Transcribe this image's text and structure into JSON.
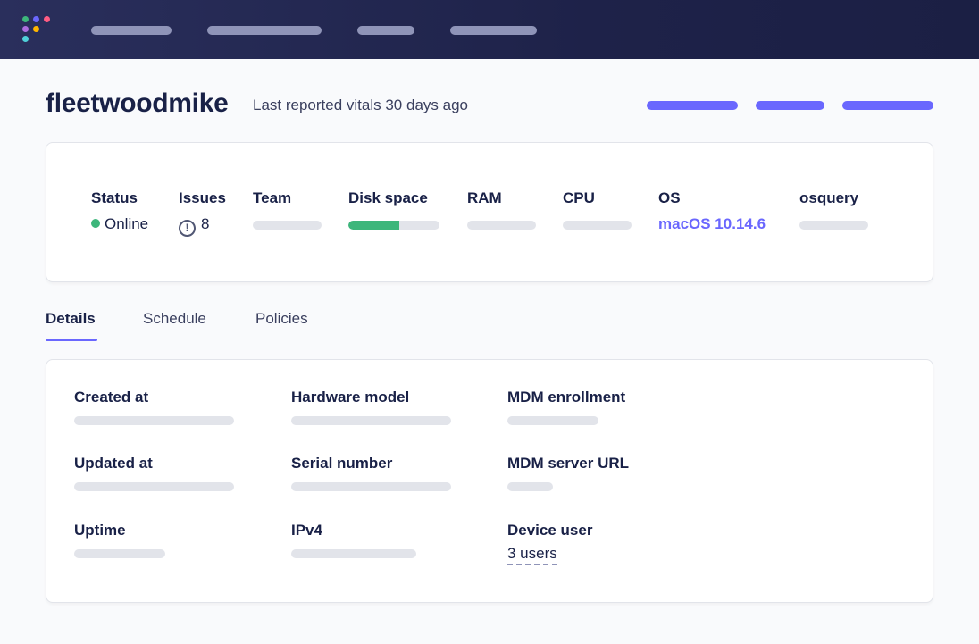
{
  "colors": {
    "topbar": "#1e2249",
    "accent": "#6a67fe",
    "online": "#3db67b",
    "skeleton": "#e2e4ea",
    "logo_dots": [
      "#3db67b",
      "#6a67fe",
      "#ff5c83",
      "#ae6ddf",
      "#ffb600",
      "#4fd0d8"
    ]
  },
  "topbar": {
    "logo_icon": "fleet-logo-icon",
    "nav_items": [
      "placeholder",
      "placeholder",
      "placeholder",
      "placeholder"
    ]
  },
  "header": {
    "hostname": "fleetwoodmike",
    "vitals_text": "Last reported vitals 30 days ago"
  },
  "summary": {
    "status": {
      "label": "Status",
      "value": "Online"
    },
    "issues": {
      "label": "Issues",
      "value": "8",
      "icon": "alert-circle-icon",
      "icon_glyph": "!"
    },
    "team": {
      "label": "Team"
    },
    "disk_space": {
      "label": "Disk space",
      "used_fraction": 0.56
    },
    "ram": {
      "label": "RAM"
    },
    "cpu": {
      "label": "CPU"
    },
    "os": {
      "label": "OS",
      "value": "macOS 10.14.6"
    },
    "osquery": {
      "label": "osquery"
    }
  },
  "tabs": [
    {
      "label": "Details",
      "active": true
    },
    {
      "label": "Schedule",
      "active": false
    },
    {
      "label": "Policies",
      "active": false
    }
  ],
  "details": {
    "created_at": {
      "label": "Created at"
    },
    "hardware_model": {
      "label": "Hardware model"
    },
    "mdm_enrollment": {
      "label": "MDM enrollment"
    },
    "updated_at": {
      "label": "Updated at"
    },
    "serial_number": {
      "label": "Serial number"
    },
    "mdm_server_url": {
      "label": "MDM server URL"
    },
    "uptime": {
      "label": "Uptime"
    },
    "ipv4": {
      "label": "IPv4"
    },
    "device_user": {
      "label": "Device user",
      "value": "3 users"
    }
  }
}
